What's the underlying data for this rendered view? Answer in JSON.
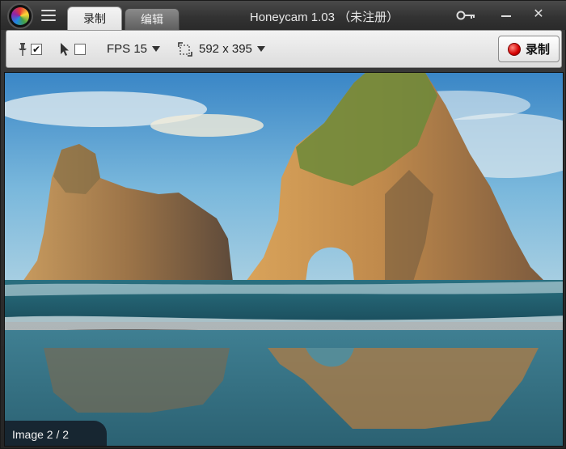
{
  "titlebar": {
    "title": "Honeycam 1.03 （未注册）",
    "tabs": [
      {
        "label": "录制",
        "active": true
      },
      {
        "label": "编辑",
        "active": false
      }
    ],
    "icons": [
      "honeycam-logo-icon",
      "menu-icon",
      "key-icon",
      "minimize-icon",
      "close-icon"
    ],
    "close_glyph": "✕"
  },
  "toolbar": {
    "pin_checked": true,
    "cursor_checked": false,
    "fps_label": "FPS 15",
    "size_label": "592 x 395",
    "record_label": "录制",
    "check_glyph": "✔"
  },
  "status": {
    "image_counter": "Image 2 / 2"
  },
  "colors": {
    "record_red": "#d50000",
    "titlebar": "#333333",
    "sea": "#1f5b6e"
  }
}
